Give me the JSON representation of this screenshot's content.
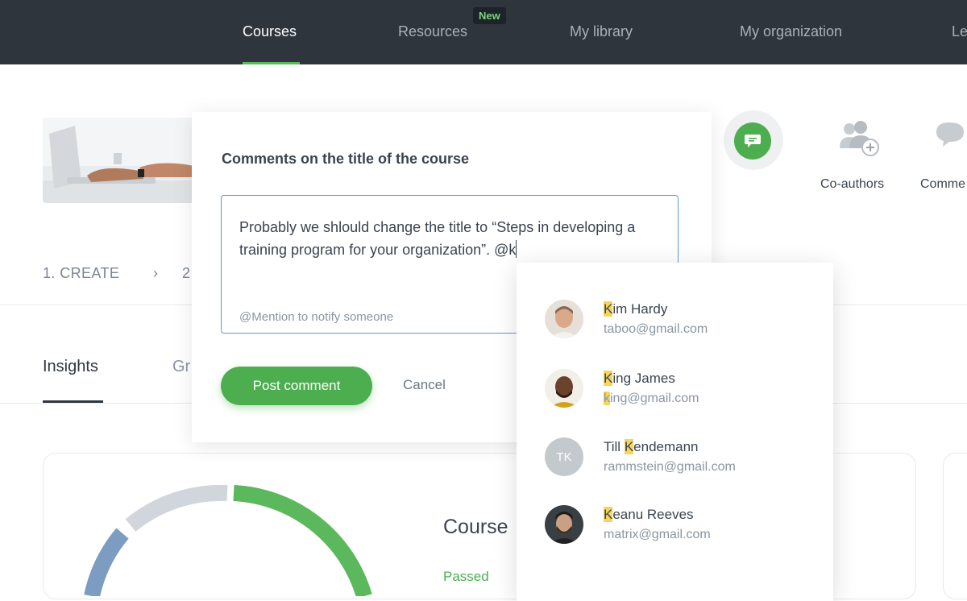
{
  "nav": {
    "items": [
      {
        "label": "Courses",
        "active": true
      },
      {
        "label": "Resources"
      },
      {
        "label": "My library"
      },
      {
        "label": "My organization"
      },
      {
        "label": "Le"
      }
    ],
    "badge": "New"
  },
  "steps": {
    "step1": "1. CREATE",
    "separator": "›",
    "step2": "2"
  },
  "tabs": {
    "insights": "Insights",
    "second_partial": "Gr"
  },
  "side_actions": {
    "coauthors_label": "Co-authors",
    "comments_label": "Comme"
  },
  "modal": {
    "title": "Comments on the title of the course",
    "comment_text": "Probably we shlould change the title to “Steps in developing a training program for your organization”. @k",
    "hint": "@Mention to notify someone",
    "post_label": "Post comment",
    "cancel_label": "Cancel"
  },
  "mentions": [
    {
      "name_hl": "K",
      "name_rest": "im Hardy",
      "email_hl": "",
      "email_rest": "taboo@gmail.com",
      "avatar": "photo"
    },
    {
      "name_hl": "K",
      "name_rest": "ing James",
      "email_hl": "k",
      "email_rest": "ing@gmail.com",
      "avatar": "photo"
    },
    {
      "name_pre": "Till ",
      "name_hl": "K",
      "name_rest": "endemann",
      "email_hl": "",
      "email_rest": "rammstein@gmail.com",
      "avatar": "initials",
      "initials": "TK"
    },
    {
      "name_hl": "K",
      "name_rest": "eanu Reeves",
      "email_hl": "",
      "email_rest": "matrix@gmail.com",
      "avatar": "photo"
    }
  ],
  "chart": {
    "heading_partial": "Course",
    "passed_label": "Passed"
  },
  "colors": {
    "nav_bg": "#2f353d",
    "accent_green": "#4cae4f",
    "input_border": "#5b9bd5",
    "mention_highlight": "#f6d55c"
  }
}
